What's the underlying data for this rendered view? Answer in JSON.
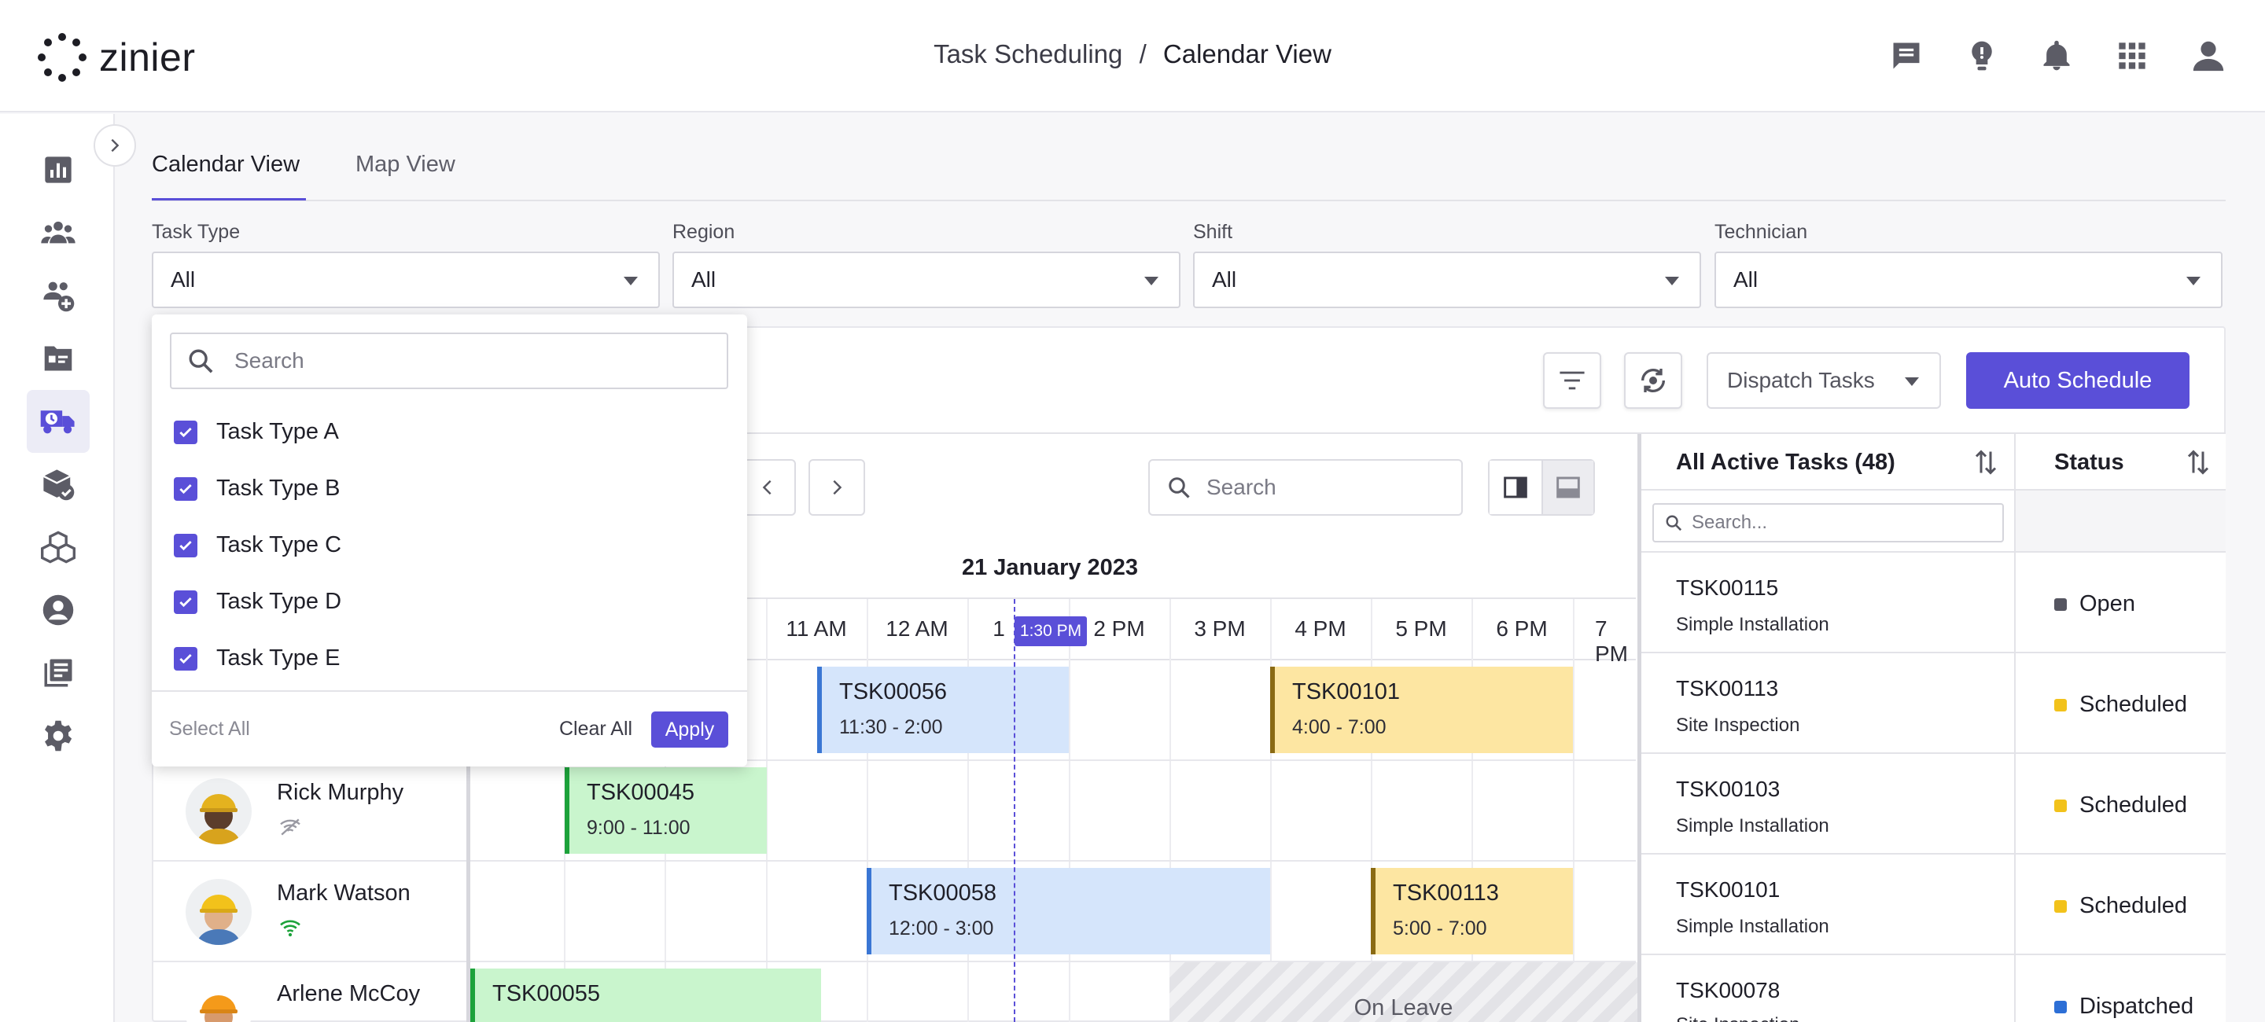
{
  "app": {
    "brand": "zinier"
  },
  "header": {
    "crumb_parent": "Task Scheduling",
    "crumb_sep": "/",
    "crumb_current": "Calendar View",
    "icons": [
      "chat-icon",
      "lightbulb-icon",
      "bell-icon",
      "apps-grid-icon",
      "user-icon"
    ]
  },
  "sidebar": {
    "icons": [
      "analytics-icon",
      "team-icon",
      "add-team-icon",
      "id-card-icon",
      "dispatch-truck-icon",
      "inventory-check-icon",
      "boxes-icon",
      "account-icon",
      "library-icon",
      "settings-icon"
    ],
    "active_index": 4
  },
  "tabs": [
    {
      "label": "Calendar View",
      "active": true
    },
    {
      "label": "Map View",
      "active": false
    }
  ],
  "filters": [
    {
      "label": "Task Type",
      "value": "All"
    },
    {
      "label": "Region",
      "value": "All"
    },
    {
      "label": "Shift",
      "value": "All"
    },
    {
      "label": "Technician",
      "value": "All"
    }
  ],
  "task_type_dropdown": {
    "search_placeholder": "Search",
    "options": [
      {
        "label": "Task Type A",
        "checked": true
      },
      {
        "label": "Task Type B",
        "checked": true
      },
      {
        "label": "Task Type C",
        "checked": true
      },
      {
        "label": "Task Type D",
        "checked": true
      },
      {
        "label": "Task Type E",
        "checked": true
      }
    ],
    "select_all": "Select All",
    "clear_all": "Clear All",
    "apply": "Apply"
  },
  "toolbar": {
    "dispatch_label": "Dispatch Tasks",
    "auto_schedule_label": "Auto Schedule"
  },
  "calendar": {
    "search_placeholder": "Search",
    "date": "21 January 2023",
    "hours": [
      "11 AM",
      "12 AM",
      "1",
      "2 PM",
      "3 PM",
      "4 PM",
      "5 PM",
      "6 PM",
      "7 PM"
    ],
    "now_label": "1:30 PM",
    "technicians": [
      {
        "name": "Rick Murphy",
        "status": "offline"
      },
      {
        "name": "Mark Watson",
        "status": "online"
      },
      {
        "name": "Arlene McCoy",
        "status": ""
      }
    ],
    "tasks": [
      {
        "id": "TSK00056",
        "time": "11:30 - 2:00",
        "color": "blue"
      },
      {
        "id": "TSK00101",
        "time": "4:00 - 7:00",
        "color": "yellow"
      },
      {
        "id": "TSK00045",
        "time": "9:00 - 11:00",
        "color": "green"
      },
      {
        "id": "TSK00058",
        "time": "12:00 - 3:00",
        "color": "blue"
      },
      {
        "id": "TSK00113",
        "time": "5:00 - 7:00",
        "color": "yellow"
      },
      {
        "id": "TSK00055",
        "time": "",
        "color": "green"
      }
    ],
    "leave_label": "On Leave"
  },
  "active_tasks": {
    "title": "All Active Tasks (48)",
    "status_header": "Status",
    "search_placeholder": "Search...",
    "rows": [
      {
        "id": "TSK00115",
        "type": "Simple Installation",
        "status": "Open",
        "status_color": "#555560"
      },
      {
        "id": "TSK00113",
        "type": "Site Inspection",
        "status": "Scheduled",
        "status_color": "#f2c21b"
      },
      {
        "id": "TSK00103",
        "type": "Simple Installation",
        "status": "Scheduled",
        "status_color": "#f2c21b"
      },
      {
        "id": "TSK00101",
        "type": "Simple Installation",
        "status": "Scheduled",
        "status_color": "#f2c21b"
      },
      {
        "id": "TSK00078",
        "type": "Site Inspection",
        "status": "Dispatched",
        "status_color": "#2d6fd6"
      }
    ]
  }
}
